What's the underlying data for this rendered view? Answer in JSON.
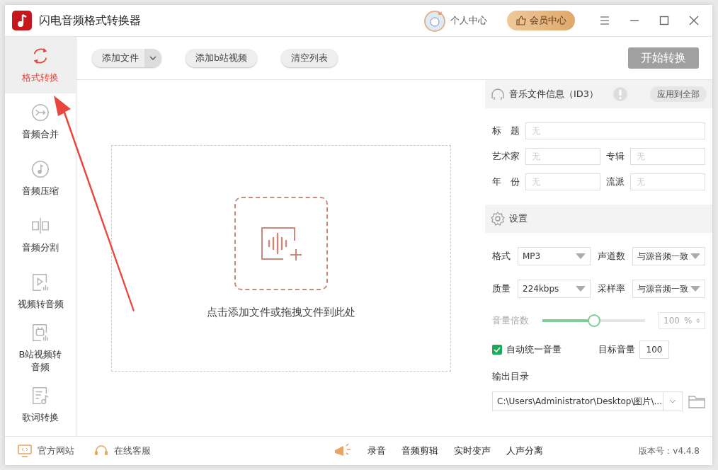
{
  "window": {
    "title": "闪电音频格式转换器"
  },
  "header": {
    "profile": "个人中心",
    "vip": "会员中心"
  },
  "sidebar": {
    "items": [
      {
        "label": "格式转换",
        "kind": "convert",
        "selected": true
      },
      {
        "label": "音频合并",
        "kind": "merge",
        "selected": false
      },
      {
        "label": "音频压缩",
        "kind": "compress",
        "selected": false
      },
      {
        "label": "音频分割",
        "kind": "split",
        "selected": false
      },
      {
        "label": "视频转音频",
        "kind": "video",
        "selected": false
      },
      {
        "label": "B站视频转音频",
        "kind": "bilibili",
        "selected": false
      },
      {
        "label": "歌词转换",
        "kind": "lyrics",
        "selected": false
      }
    ]
  },
  "toolbar": {
    "buttons": [
      {
        "label": "添加文件",
        "kind": "dropdown"
      },
      {
        "label": "添加b站视频",
        "kind": "plain"
      },
      {
        "label": "清空列表",
        "kind": "plain"
      }
    ],
    "start": "开始转换"
  },
  "dropzone": {
    "hint": "点击添加文件或拖拽文件到此处"
  },
  "id3": {
    "title": "音乐文件信息（ID3）",
    "apply": "应用到全部",
    "fields": [
      {
        "label": "标　题",
        "placeholder": "无",
        "kind": "wide"
      },
      {
        "label": "艺术家",
        "placeholder": "无",
        "kind": "half"
      },
      {
        "label": "专辑",
        "placeholder": "无",
        "kind": "half"
      },
      {
        "label": "年　份",
        "placeholder": "无",
        "kind": "half"
      },
      {
        "label": "流派",
        "placeholder": "无",
        "kind": "half"
      }
    ]
  },
  "settings": {
    "title": "设置",
    "selects": [
      {
        "label": "格式",
        "value": "MP3"
      },
      {
        "label": "声道数",
        "value": "与源音频一致"
      },
      {
        "label": "质量",
        "value": "224kbps"
      },
      {
        "label": "采样率",
        "value": "与源音频一致"
      }
    ],
    "volume": {
      "label": "音量倍数",
      "level": 0.5,
      "value": "100",
      "unit": "%",
      "disabled": true
    },
    "auto": {
      "label": "自动统一音量",
      "checked": true
    },
    "target": {
      "label": "目标音量",
      "value": "100"
    },
    "output": {
      "label": "输出目录",
      "path": "C:\\Users\\Administrator\\Desktop\\图片\\..."
    }
  },
  "footer": {
    "links": [
      {
        "label": "官方网站",
        "kind": "web"
      },
      {
        "label": "在线客服",
        "kind": "support"
      }
    ],
    "tools": [
      "录音",
      "音频剪辑",
      "实时变声",
      "人声分离"
    ],
    "version": "版本号：v4.4.8"
  }
}
